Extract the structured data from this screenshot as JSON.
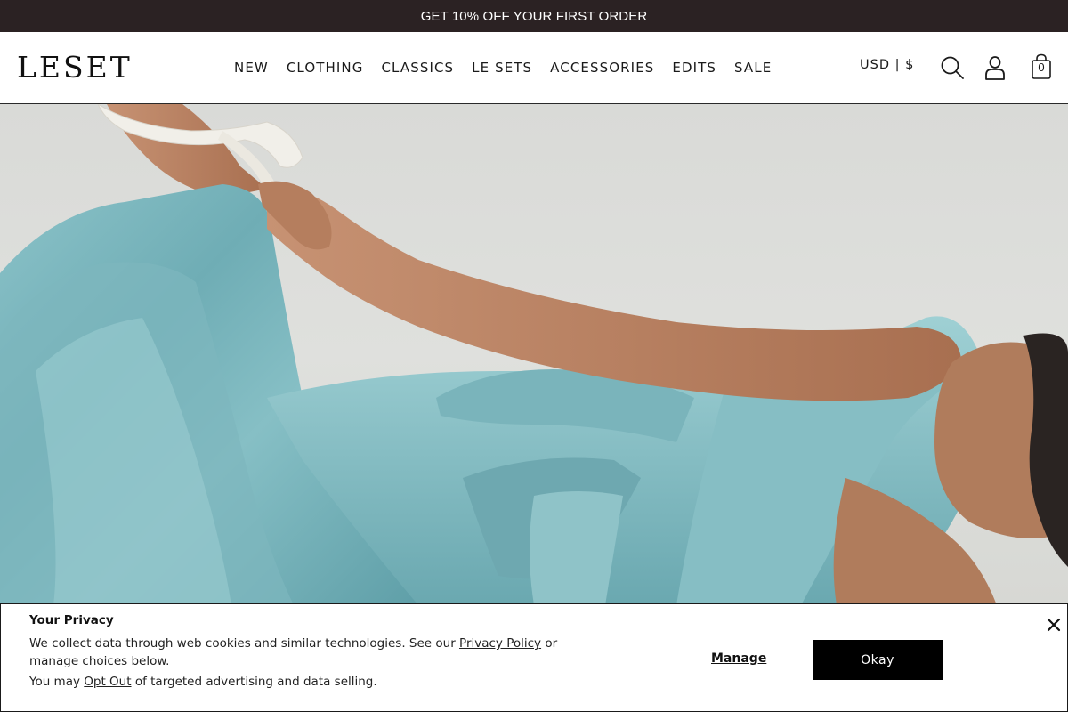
{
  "announcement": {
    "text": "GET 10% OFF YOUR FIRST ORDER"
  },
  "header": {
    "logo": "LESET",
    "nav": [
      "NEW",
      "CLOTHING",
      "CLASSICS",
      "LE SETS",
      "ACCESSORIES",
      "EDITS",
      "SALE"
    ],
    "currency": "USD | $",
    "icons": {
      "search": "search-icon",
      "account": "user-icon",
      "bag": "shopping-bag-icon"
    },
    "bag_count": "0"
  },
  "hero": {
    "image": "model-in-aqua-satin-dress",
    "colors": {
      "background": "#dcddda",
      "dress": "#7fb8bf",
      "skin": "#b07c5c",
      "shoe": "#f1efe9"
    }
  },
  "privacy": {
    "title": "Your Privacy",
    "line1_prefix": "We collect data through web cookies and similar technologies. See our ",
    "privacy_link": "Privacy Policy",
    "line1_suffix": " or manage choices below.",
    "line2_prefix": "You may ",
    "opt_out_link": "Opt Out",
    "line2_suffix": " of targeted advertising and data selling.",
    "manage_label": "Manage",
    "okay_label": "Okay",
    "close_icon": "close-icon"
  },
  "colors": {
    "announce_bg": "#2b2223",
    "button_bg": "#000000",
    "text": "#1a1a1a"
  }
}
